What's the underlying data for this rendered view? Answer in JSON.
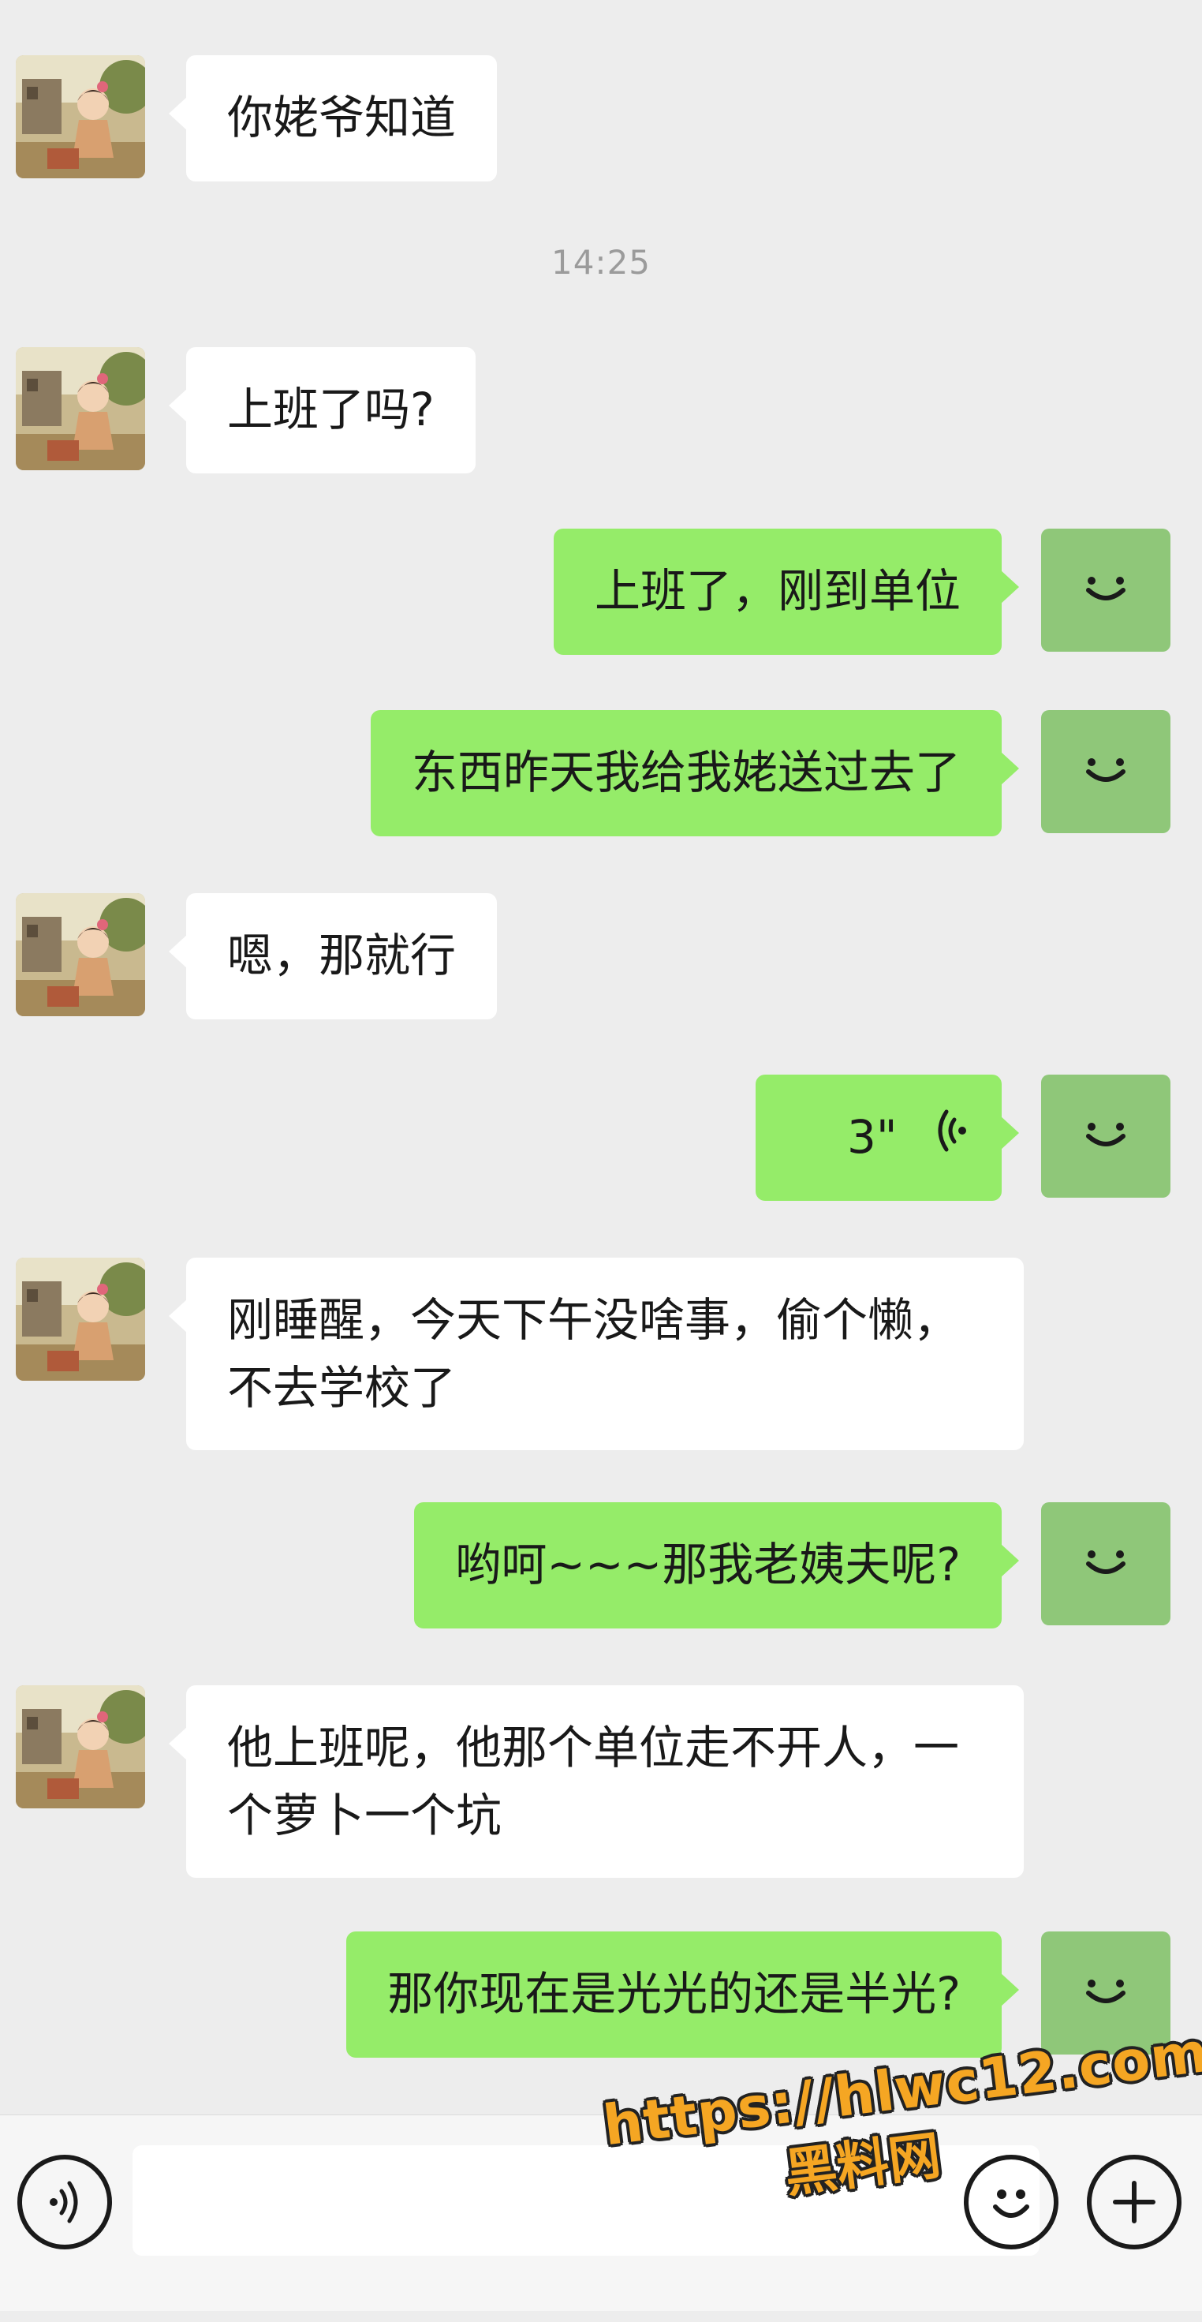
{
  "chat": {
    "timestamp": "14:25",
    "messages": [
      {
        "from": "other",
        "text": "你姥爷知道"
      },
      {
        "from": "other",
        "text": "上班了吗?"
      },
      {
        "from": "self",
        "text": "上班了，刚到单位"
      },
      {
        "from": "self",
        "text": "东西昨天我给我姥送过去了"
      },
      {
        "from": "other",
        "text": "嗯，那就行"
      },
      {
        "from": "self",
        "type": "voice",
        "duration": "3\""
      },
      {
        "from": "other",
        "text": "刚睡醒，今天下午没啥事，偷个懒，不去学校了"
      },
      {
        "from": "self",
        "text": "哟呵~~~那我老姨夫呢?"
      },
      {
        "from": "other",
        "text": "他上班呢，他那个单位走不开人，一个萝卜一个坑"
      },
      {
        "from": "self",
        "text": "那你现在是光光的还是半光?"
      }
    ],
    "self_avatar_icon": "smile-icon",
    "other_avatar_icon": "cartoon-girl-avatar"
  },
  "input_bar": {
    "voice_icon": "voice-mode-icon",
    "emoji_icon": "emoji-icon",
    "plus_icon": "plus-icon"
  },
  "watermark": {
    "url": "https://hlwc12.com",
    "name": "黑料网"
  },
  "colors": {
    "background": "#ededed",
    "self_bubble": "#95ec69",
    "other_bubble": "#ffffff",
    "self_avatar": "#8fc779",
    "watermark": "#f5a623"
  }
}
